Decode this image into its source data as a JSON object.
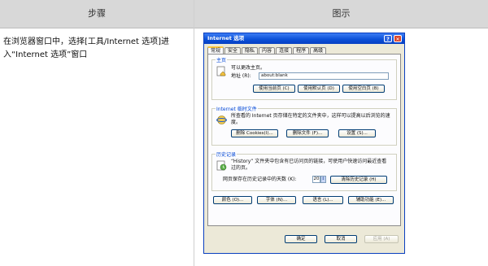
{
  "table": {
    "col1_header": "步骤",
    "col2_header": "图示",
    "step_text": "在浏览器窗口中，选择[工具/Internet 选项]进入“Internet 选项”窗口"
  },
  "dialog": {
    "title": "Internet 选项",
    "help_glyph": "?",
    "close_glyph": "✕",
    "tabs": [
      "常规",
      "安全",
      "隐私",
      "内容",
      "连接",
      "程序",
      "高级"
    ],
    "home": {
      "legend": "主页",
      "hint": "可以更改主页。",
      "address_label": "地址 (R):",
      "address_value": "about:blank",
      "buttons": [
        "使用当前页 (C)",
        "使用默认页 (D)",
        "使用空白页 (B)"
      ]
    },
    "temp_files": {
      "legend": "Internet 临时文件",
      "desc": "所查看的 Internet 页存储在特定的文件夹中，这样可以提高以后浏览的速度。",
      "buttons": [
        "删除 Cookies(I)...",
        "删除文件 (F)...",
        "设置 (S)..."
      ]
    },
    "history": {
      "legend": "历史记录",
      "desc": "“History” 文件夹中包含有已访问页的链接，可使用户快速访问最近查看过的页。",
      "days_label": "网页保存在历史记录中的天数 (K):",
      "days_value": "20",
      "clear_button": "清除历史记录 (H)"
    },
    "bottom_buttons": [
      "颜色 (O)...",
      "字体 (N)...",
      "语言 (L)...",
      "辅助功能 (E)..."
    ],
    "footer_buttons": [
      "确定",
      "取消",
      "应用 (A)"
    ]
  }
}
